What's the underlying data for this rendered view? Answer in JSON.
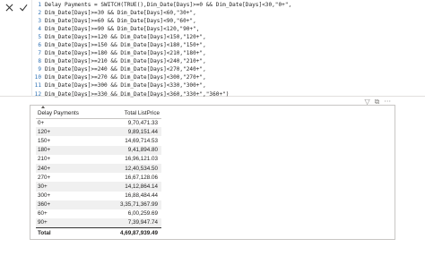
{
  "formula_bar": {
    "cancel_icon": "close-icon",
    "commit_icon": "checkmark-icon",
    "lines": [
      {
        "n": "1",
        "text": "Delay Payments = SWITCH(TRUE(),Dim_Date[Days]>=0 && Dim_Date[Days]<30,\"0+\","
      },
      {
        "n": "2",
        "text": "Dim_Date[Days]>=30 && Dim_Date[Days]<60,\"30+\","
      },
      {
        "n": "3",
        "text": "Dim_Date[Days]>=60 && Dim_Date[Days]<90,\"60+\","
      },
      {
        "n": "4",
        "text": "Dim_Date[Days]>=90 && Dim_Date[Days]<120,\"90+\","
      },
      {
        "n": "5",
        "text": "Dim_Date[Days]>=120 && Dim_Date[Days]<150,\"120+\","
      },
      {
        "n": "6",
        "text": "Dim_Date[Days]>=150 && Dim_Date[Days]<180,\"150+\","
      },
      {
        "n": "7",
        "text": "Dim_Date[Days]>=180 && Dim_Date[Days]<210,\"180+\","
      },
      {
        "n": "8",
        "text": "Dim_Date[Days]>=210 && Dim_Date[Days]<240,\"210+\","
      },
      {
        "n": "9",
        "text": "Dim_Date[Days]>=240 && Dim_Date[Days]<270,\"240+\","
      },
      {
        "n": "10",
        "text": "Dim_Date[Days]>=270 && Dim_Date[Days]<300,\"270+\","
      },
      {
        "n": "11",
        "text": "Dim_Date[Days]>=300 && Dim_Date[Days]<330,\"300+\","
      },
      {
        "n": "12",
        "text": "Dim_Date[Days]>=330 && Dim_Date[Days]<360,\"330+\",\"360+\")"
      }
    ]
  },
  "visual": {
    "header_icons": [
      "filter-icon",
      "focus-mode-icon",
      "more-options-icon"
    ],
    "header_glyphs": [
      "▽",
      "⧉",
      "···"
    ],
    "table": {
      "columns": [
        "Delay Payments",
        "Total ListPrice"
      ],
      "rows": [
        [
          "0+",
          "9,70,471.33"
        ],
        [
          "120+",
          "9,89,151.44"
        ],
        [
          "150+",
          "14,69,714.53"
        ],
        [
          "180+",
          "9,41,894.80"
        ],
        [
          "210+",
          "16,96,121.03"
        ],
        [
          "240+",
          "12,40,534.50"
        ],
        [
          "270+",
          "16,67,128.06"
        ],
        [
          "30+",
          "14,12,864.14"
        ],
        [
          "300+",
          "16,88,484.44"
        ],
        [
          "360+",
          "3,35,71,367.99"
        ],
        [
          "60+",
          "6,00,259.69"
        ],
        [
          "90+",
          "7,39,947.74"
        ]
      ],
      "total_label": "Total",
      "total_value": "4,69,87,939.49"
    }
  }
}
